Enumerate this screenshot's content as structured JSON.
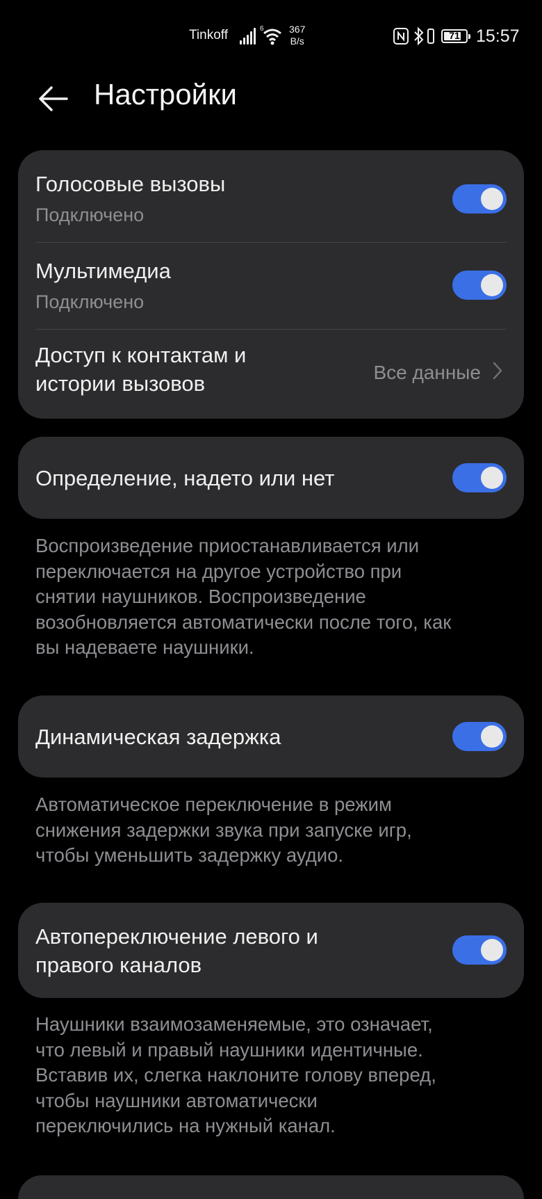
{
  "status_bar": {
    "carrier": "Tinkoff",
    "network": "6",
    "speed_value": "367",
    "speed_unit": "B/s",
    "battery": "71",
    "time": "15:57",
    "icons": [
      "signal-icon",
      "wifi-icon",
      "nfc-icon",
      "bluetooth-icon",
      "vibrate-icon",
      "battery-icon"
    ]
  },
  "header": {
    "title": "Настройки",
    "back_icon": "arrow-left-icon"
  },
  "connections": {
    "voice": {
      "label": "Голосовые вызовы",
      "status": "Подключено",
      "enabled": true
    },
    "media": {
      "label": "Мультимедиа",
      "status": "Подключено",
      "enabled": true
    },
    "contacts": {
      "label_line1": "Доступ к контактам и",
      "label_line2": "истории вызовов",
      "value": "Все данные"
    }
  },
  "wear_detection": {
    "label": "Определение, надето или нет",
    "enabled": true,
    "description": [
      "Воспроизведение приостанавливается или",
      "переключается на другое устройство при",
      "снятии наушников. Воспроизведение",
      "возобновляется автоматически после того, как",
      "вы надеваете наушники."
    ]
  },
  "dynamic_latency": {
    "label": "Динамическая задержка",
    "enabled": true,
    "description": [
      "Автоматическое переключение в режим",
      "снижения задержки звука при запуске игр,",
      "чтобы уменьшить задержку аудио."
    ]
  },
  "auto_channel": {
    "label_line1": "Автопереключение левого и",
    "label_line2": "правого каналов",
    "enabled": true,
    "description": [
      "Наушники взаимозаменяемые, это означает,",
      "что левый и правый наушники идентичные.",
      "Вставив их, слегка наклоните голову вперед,",
      "чтобы наушники автоматически",
      "переключились на нужный канал."
    ]
  },
  "colors": {
    "background": "#000000",
    "card": "#2c2c2e",
    "accent": "#3b6fe6",
    "secondary_text": "#8e8e93"
  }
}
